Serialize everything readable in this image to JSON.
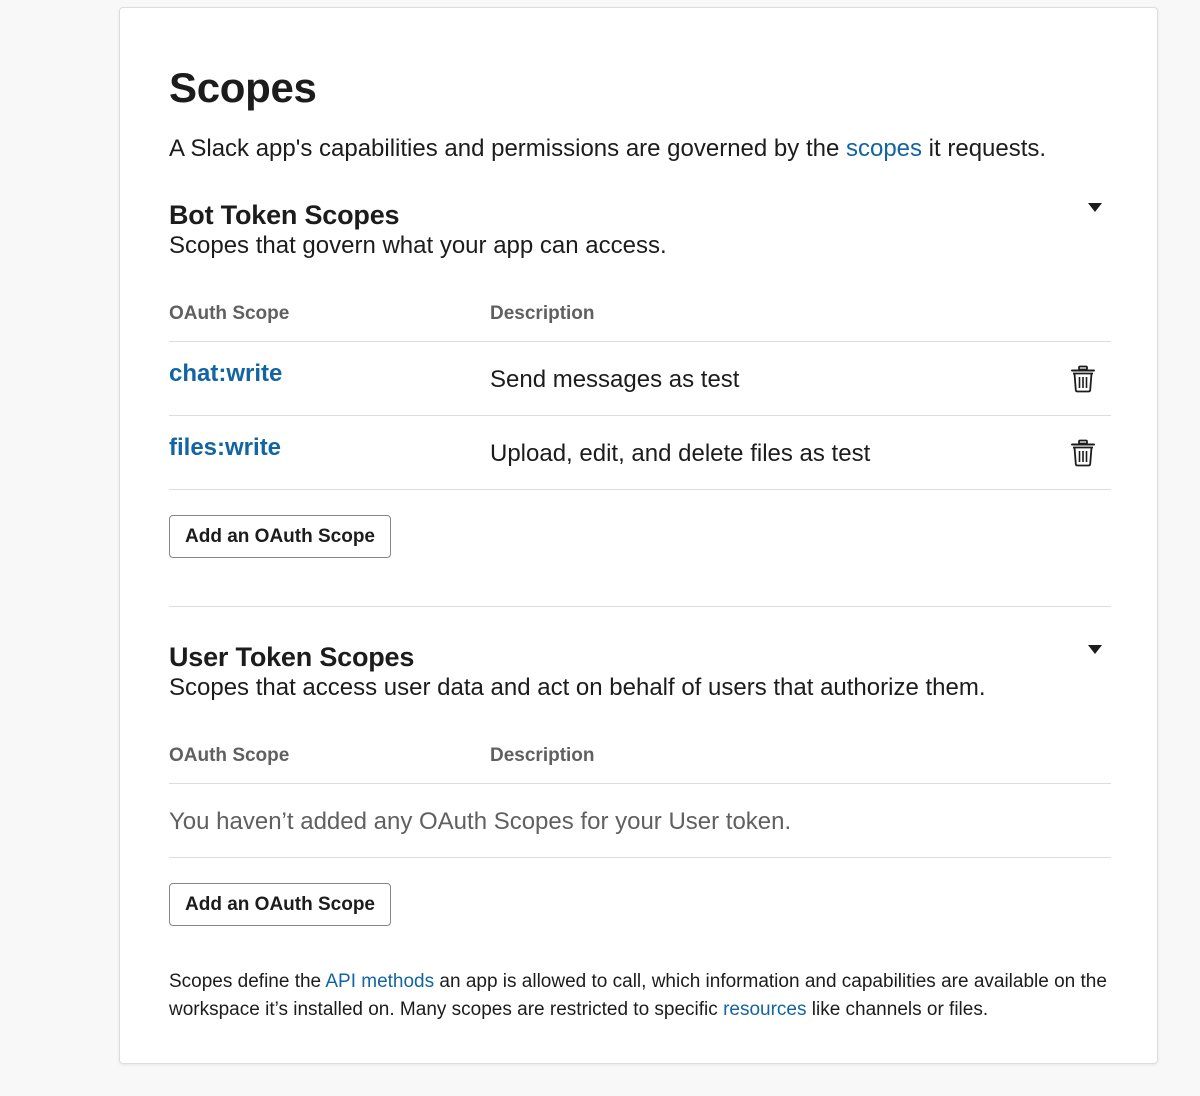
{
  "page": {
    "title": "Scopes",
    "intro": {
      "before": "A Slack app's capabilities and permissions are governed by the ",
      "link": "scopes",
      "after": " it requests."
    }
  },
  "bot_section": {
    "title": "Bot Token Scopes",
    "description": "Scopes that govern what your app can access.",
    "columns": [
      "OAuth Scope",
      "Description"
    ],
    "rows": [
      {
        "scope": "chat:write",
        "description": "Send messages as test"
      },
      {
        "scope": "files:write",
        "description": "Upload, edit, and delete files as test"
      }
    ],
    "add_button": "Add an OAuth Scope"
  },
  "user_section": {
    "title": "User Token Scopes",
    "description": "Scopes that access user data and act on behalf of users that authorize them.",
    "columns": [
      "OAuth Scope",
      "Description"
    ],
    "empty_message": "You haven’t added any OAuth Scopes for your User token.",
    "add_button": "Add an OAuth Scope"
  },
  "footer": {
    "part1": "Scopes define the ",
    "link1": "API methods",
    "part2": " an app is allowed to call, which information and capabilities are available on the workspace it’s installed on. Many scopes are restricted to specific ",
    "link2": "resources",
    "part3": " like channels or files."
  },
  "icons": {
    "trash": "trash-icon",
    "caret": "caret-down-icon"
  },
  "colors": {
    "link": "#1264a3",
    "text": "#1d1c1d",
    "muted": "#616061",
    "divider": "#dddddd"
  }
}
